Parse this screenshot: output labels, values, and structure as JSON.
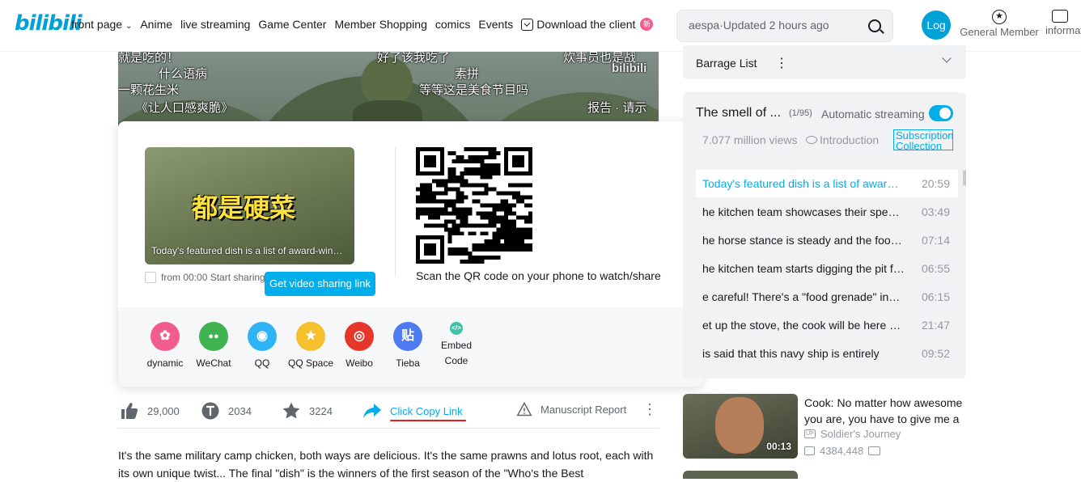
{
  "header": {
    "logo": "bilibili",
    "nav": [
      "front page",
      "Anime",
      "live streaming",
      "Game Center",
      "Member Shopping",
      "comics",
      "Events"
    ],
    "nav_chevron_item": "front page",
    "download_label": "Download the client",
    "new_badge": "新",
    "search_value": "aespa·Updated 2 hours ago",
    "avatar_text": "Log",
    "member_label": "General Member",
    "member_icon_glyph": "★",
    "info_label": "information"
  },
  "video": {
    "subtitles": [
      "就是吃的！",
      "什么语病",
      "一颗花生米",
      "《让人口感爽脆》",
      "好了该我吃了",
      "素拼",
      "等等这是美食节目吗",
      "炊事员也是战",
      "报告 · 请示"
    ],
    "watermark": "bilibili"
  },
  "share": {
    "thumb_big_text": "都是硬菜",
    "thumb_caption": "Today's featured dish is a list of award-winning dishes",
    "start_label": "from 00:00 Start sharing",
    "get_link_button": "Get video sharing link",
    "qr_caption": "Scan the QR code on your phone to watch/share",
    "targets": [
      {
        "label": "dynamic",
        "glyph": "✿",
        "color": "#f25d8e"
      },
      {
        "label": "WeChat",
        "glyph": "●●",
        "color": "#3fb34f"
      },
      {
        "label": "QQ",
        "glyph": "◉",
        "color": "#2eb4f5"
      },
      {
        "label": "QQ Space",
        "glyph": "★",
        "color": "#f6c02d"
      },
      {
        "label": "Weibo",
        "glyph": "◎",
        "color": "#e6362a"
      },
      {
        "label": "Tieba",
        "glyph": "贴",
        "color": "#4f7bf2"
      }
    ],
    "embed_label_1": "Embed",
    "embed_label_2": "Code"
  },
  "actions": {
    "likes": "29,000",
    "coins": "2034",
    "favorites": "3224",
    "copy_link": "Click Copy Link",
    "report": "Manuscript Report"
  },
  "description": "It's the same military camp chicken, both ways are delicious. It's the same prawns and lotus root, each with its own unique twist... The final \"dish\" is the winners of the first season of the \"Who's the Best",
  "barrage": {
    "title": "Barrage List"
  },
  "playlist": {
    "title": "The smell of ...",
    "count": "(1/95)",
    "auto_label": "Automatic streaming",
    "views": "7.077 million views",
    "intro": "Introduction",
    "subscribe_label": "Subscription Collection",
    "episodes": [
      {
        "title": "Today's featured dish is a list of award-winning dishes",
        "duration": "20:59",
        "active": true
      },
      {
        "title": "he kitchen team showcases their special skills",
        "duration": "03:49"
      },
      {
        "title": "he horse stance is steady and the food is served",
        "duration": "07:14"
      },
      {
        "title": "he kitchen team starts digging the pit for cooking",
        "duration": "06:55"
      },
      {
        "title": "e careful! There's a \"food grenade\" incoming",
        "duration": "06:15"
      },
      {
        "title": "et up the stove, the cook will be here soon",
        "duration": "21:47"
      },
      {
        "title": " is said that this navy ship is entirely",
        "duration": "09:52"
      }
    ]
  },
  "recommended": {
    "title": "Cook: No matter how awesome you are, you have to give me a special forces soldier",
    "uploader": "Soldier's Journey",
    "up_badge": "UP",
    "views": "4384,448",
    "duration": "00:13"
  }
}
